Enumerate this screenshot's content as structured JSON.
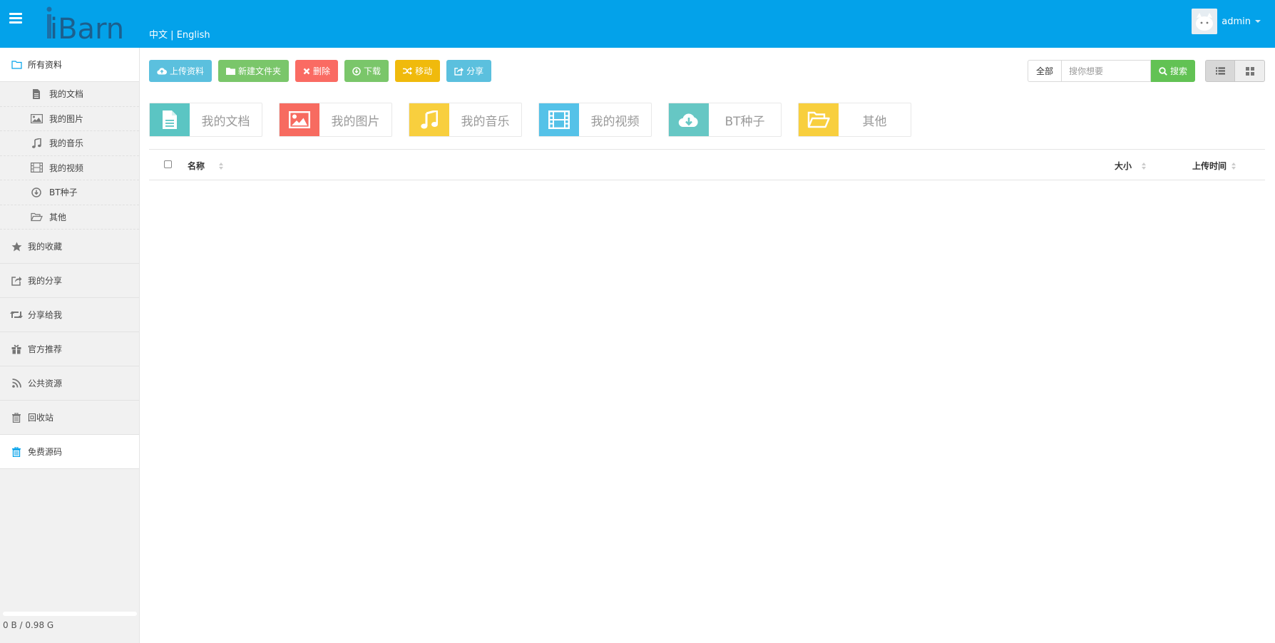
{
  "header": {
    "logo_text": "iBarn",
    "lang_zh": "中文",
    "lang_sep": "|",
    "lang_en": "English",
    "username": "admin"
  },
  "sidebar": {
    "all_files": "所有资料",
    "sub_items": [
      {
        "label": "我的文档",
        "icon": "file-text-icon"
      },
      {
        "label": "我的图片",
        "icon": "image-icon"
      },
      {
        "label": "我的音乐",
        "icon": "music-icon"
      },
      {
        "label": "我的视频",
        "icon": "film-icon"
      },
      {
        "label": "BT种子",
        "icon": "download-circle-icon"
      },
      {
        "label": "其他",
        "icon": "folder-open-icon"
      }
    ],
    "items": [
      {
        "label": "我的收藏",
        "icon": "star-icon"
      },
      {
        "label": "我的分享",
        "icon": "share-square-icon"
      },
      {
        "label": "分享给我",
        "icon": "retweet-icon"
      },
      {
        "label": "官方推荐",
        "icon": "gift-icon"
      },
      {
        "label": "公共资源",
        "icon": "rss-icon"
      },
      {
        "label": "回收站",
        "icon": "trash-icon"
      },
      {
        "label": "免费源码",
        "icon": "trash-icon"
      }
    ],
    "quota_text": "0 B / 0.98 G",
    "quota_fraction": 0
  },
  "toolbar": {
    "upload": "上传资料",
    "new_folder": "新建文件夹",
    "delete": "删除",
    "download": "下载",
    "move": "移动",
    "share": "分享"
  },
  "search": {
    "scope": "全部",
    "placeholder": "搜你想要",
    "button": "搜索"
  },
  "categories": [
    {
      "label": "我的文档",
      "color": "#5bc5c3",
      "icon": "file-text-icon"
    },
    {
      "label": "我的图片",
      "color": "#f76b60",
      "icon": "image-icon"
    },
    {
      "label": "我的音乐",
      "color": "#f8cf3e",
      "icon": "music-icon"
    },
    {
      "label": "我的视频",
      "color": "#55c2e8",
      "icon": "film-icon"
    },
    {
      "label": "BT种子",
      "color": "#66c7c4",
      "icon": "cloud-download-icon"
    },
    {
      "label": "其他",
      "color": "#f8cf3e",
      "icon": "folder-open-icon"
    }
  ],
  "table": {
    "col_name": "名称",
    "col_size": "大小",
    "col_time": "上传时间"
  },
  "colors": {
    "header_bg": "#03a2ea",
    "sidebar_bg": "#f1f1f1"
  }
}
